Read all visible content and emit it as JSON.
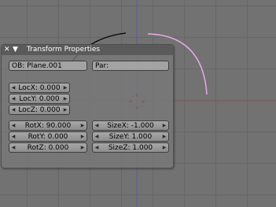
{
  "panel": {
    "title": "Transform Properties",
    "icons": {
      "close": "close-icon",
      "collapse": "collapse-triangle-icon"
    },
    "object_name": "OB: Plane.001",
    "parent": "Par:",
    "location": {
      "x": "LocX: 0.000",
      "y": "LocY: 0.000",
      "z": "LocZ: 0.000"
    },
    "rotation": {
      "x": "RotX: 90.000",
      "y": "RotY: 0.000",
      "z": "RotZ: 0.000"
    },
    "size": {
      "x": "SizeX: -1.000",
      "y": "SizeY: 1.000",
      "z": "SizeZ: 1.000"
    }
  },
  "colors": {
    "viewport_bg": "#727272",
    "grid_line": "#676767",
    "axis_x": "#a05252",
    "axis_y": "#5a5a9e",
    "selected_curve": "#e8a8e8",
    "curve": "#000000",
    "cursor_ring": "#c02020"
  }
}
